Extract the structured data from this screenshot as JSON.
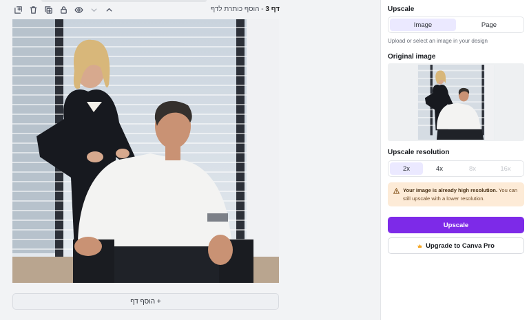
{
  "canvas": {
    "page_label_bold": "דף 3",
    "page_label_rest": " - הוסף כותרת לדף",
    "add_page_label": "+ הוסף דף",
    "toolbar_icons": [
      "add-note-icon",
      "trash-icon",
      "duplicate-icon",
      "lock-icon",
      "eye-icon",
      "chevron-down-icon",
      "chevron-up-icon"
    ]
  },
  "panel": {
    "upscale_title": "Upscale",
    "target_tabs": [
      {
        "label": "Image",
        "active": true
      },
      {
        "label": "Page",
        "active": false
      }
    ],
    "hint": "Upload or select an image in your design",
    "original_title": "Original image",
    "resolution_title": "Upscale resolution",
    "resolutions": [
      {
        "label": "2x",
        "state": "active"
      },
      {
        "label": "4x",
        "state": "enabled"
      },
      {
        "label": "8x",
        "state": "disabled"
      },
      {
        "label": "16x",
        "state": "disabled"
      }
    ],
    "alert_bold": "Your image is already high resolution.",
    "alert_rest": " You can still upscale with a lower resolution.",
    "upscale_button": "Upscale",
    "upgrade_button": "Upgrade to Canva Pro"
  },
  "colors": {
    "accent": "#7d2ae8",
    "active_tab": "#ebe9ff",
    "alert_bg": "#fdebd7",
    "crown": "#f5a623"
  }
}
